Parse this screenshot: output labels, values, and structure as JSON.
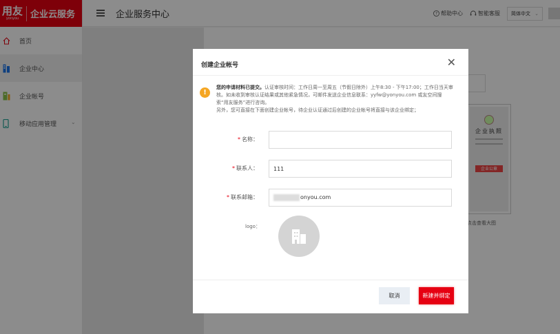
{
  "brand": {
    "logo_main": "用友",
    "logo_sub": "yonyou",
    "product": "企业云服务",
    "color": "#e60012"
  },
  "sidebar": {
    "items": [
      {
        "label": "首页",
        "icon": "home-icon"
      },
      {
        "label": "企业中心",
        "icon": "enterprise-icon"
      },
      {
        "label": "企业帐号",
        "icon": "account-icon"
      },
      {
        "label": "移动应用管理",
        "icon": "mobile-icon"
      }
    ]
  },
  "header": {
    "title": "企业服务中心",
    "help": "帮助中心",
    "service": "智能客服",
    "language": "简体中文"
  },
  "background": {
    "license_title": "企业执照",
    "license_stamp": "企业公章",
    "caption": "点击查看大图"
  },
  "modal": {
    "title": "创建企业帐号",
    "close": "✕",
    "notice_bold": "您的申请材料已提交。",
    "notice_text": "认证审核时间：工作日周一至周五（节假日除外）上午8:30 - 下午17:00；工作日当天审核。如未收到审核认证结果或其他紧急情况，可邮件发送企业信息联系：yyfw@yonyou.com 或友空间搜索“用友服务”进行咨询。",
    "notice_text2": "另外，您可直接在下面创建企业帐号，待企业认证通过后创建的企业帐号将直接与该企业绑定；",
    "fields": {
      "name_label": "名称：",
      "name_value": "",
      "contact_label": "联系人：",
      "contact_value": "111",
      "email_label": "联系邮箱：",
      "email_value": "onyou.com",
      "logo_label": "logo："
    },
    "cancel": "取消",
    "confirm": "新建并绑定"
  }
}
